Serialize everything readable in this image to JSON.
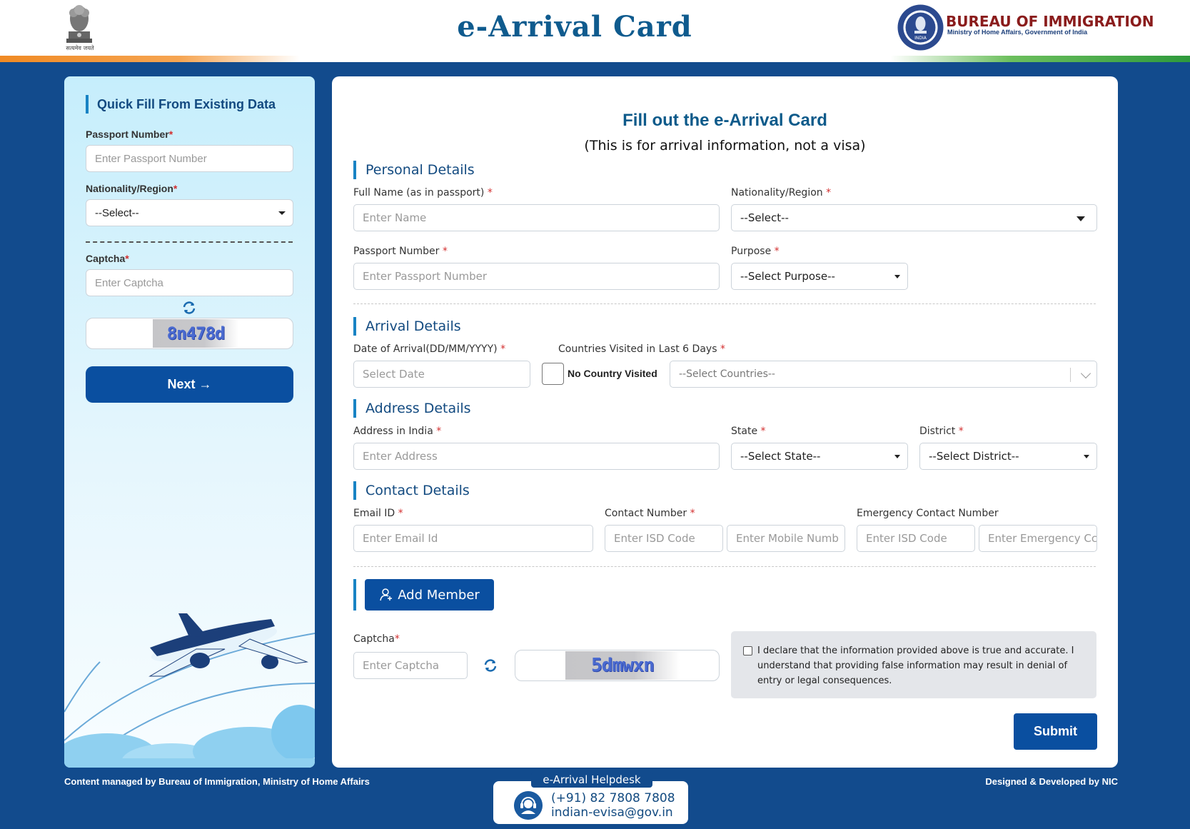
{
  "header": {
    "emblem_caption": "सत्यमेव जयते",
    "title": "e-Arrival Card",
    "org_name": "BUREAU OF IMMIGRATION",
    "org_sub": "Ministry of Home Affairs, Government of India",
    "seal_text": "INDIA"
  },
  "quick_fill": {
    "title": "Quick Fill From Existing Data",
    "passport_label": "Passport Number",
    "passport_placeholder": "Enter Passport Number",
    "nationality_label": "Nationality/Region",
    "nationality_value": "--Select--",
    "captcha_label": "Captcha",
    "captcha_placeholder": "Enter Captcha",
    "captcha_text": "8n478d",
    "next_label": "Next →"
  },
  "form": {
    "title": "Fill out the e-Arrival Card",
    "subtitle": "(This is for arrival information, not a visa)",
    "personal": {
      "title": "Personal Details",
      "full_name_label": "Full Name (as in passport)",
      "full_name_placeholder": "Enter Name",
      "nationality_label": "Nationality/Region",
      "nationality_value": "--Select--",
      "passport_label": "Passport Number",
      "passport_placeholder": "Enter Passport Number",
      "purpose_label": "Purpose",
      "purpose_value": "--Select Purpose--"
    },
    "arrival": {
      "title": "Arrival Details",
      "date_label": "Date of Arrival(DD/MM/YYYY)",
      "date_placeholder": "Select Date",
      "countries_label": "Countries Visited in Last 6 Days",
      "no_country_label": "No Country Visited",
      "countries_value": "--Select Countries--"
    },
    "address": {
      "title": "Address Details",
      "address_label": "Address in India",
      "address_placeholder": "Enter Address",
      "state_label": "State",
      "state_value": "--Select State--",
      "district_label": "District",
      "district_value": "--Select District--"
    },
    "contact": {
      "title": "Contact Details",
      "email_label": "Email ID",
      "email_placeholder": "Enter Email Id",
      "contact_label": "Contact Number",
      "isd_placeholder": "Enter ISD Code",
      "mobile_placeholder": "Enter Mobile Numb",
      "emergency_label": "Emergency Contact Number",
      "emergency_isd_placeholder": "Enter ISD Code",
      "emergency_placeholder": "Enter Emergency Cc"
    },
    "add_member_label": "Add Member",
    "captcha_label": "Captcha",
    "captcha_placeholder": "Enter Captcha",
    "captcha_text": "5dmwxn",
    "declaration": "I declare that the information provided above is true and accurate. I understand that providing false information may result in denial of entry or legal consequences.",
    "submit_label": "Submit"
  },
  "footer": {
    "left": "Content managed by Bureau of Immigration, Ministry of Home Affairs",
    "right": "Designed & Developed by NIC",
    "helpdesk_title": "e-Arrival Helpdesk",
    "helpdesk_phone": "(+91) 82 7808 7808",
    "helpdesk_email": "indian-evisa@gov.in"
  },
  "required_mark": "*",
  "colors": {
    "page_bg": "#124b8d",
    "primary_button": "#0a4fa0",
    "heading": "#124a80",
    "required": "#d32f2f"
  }
}
